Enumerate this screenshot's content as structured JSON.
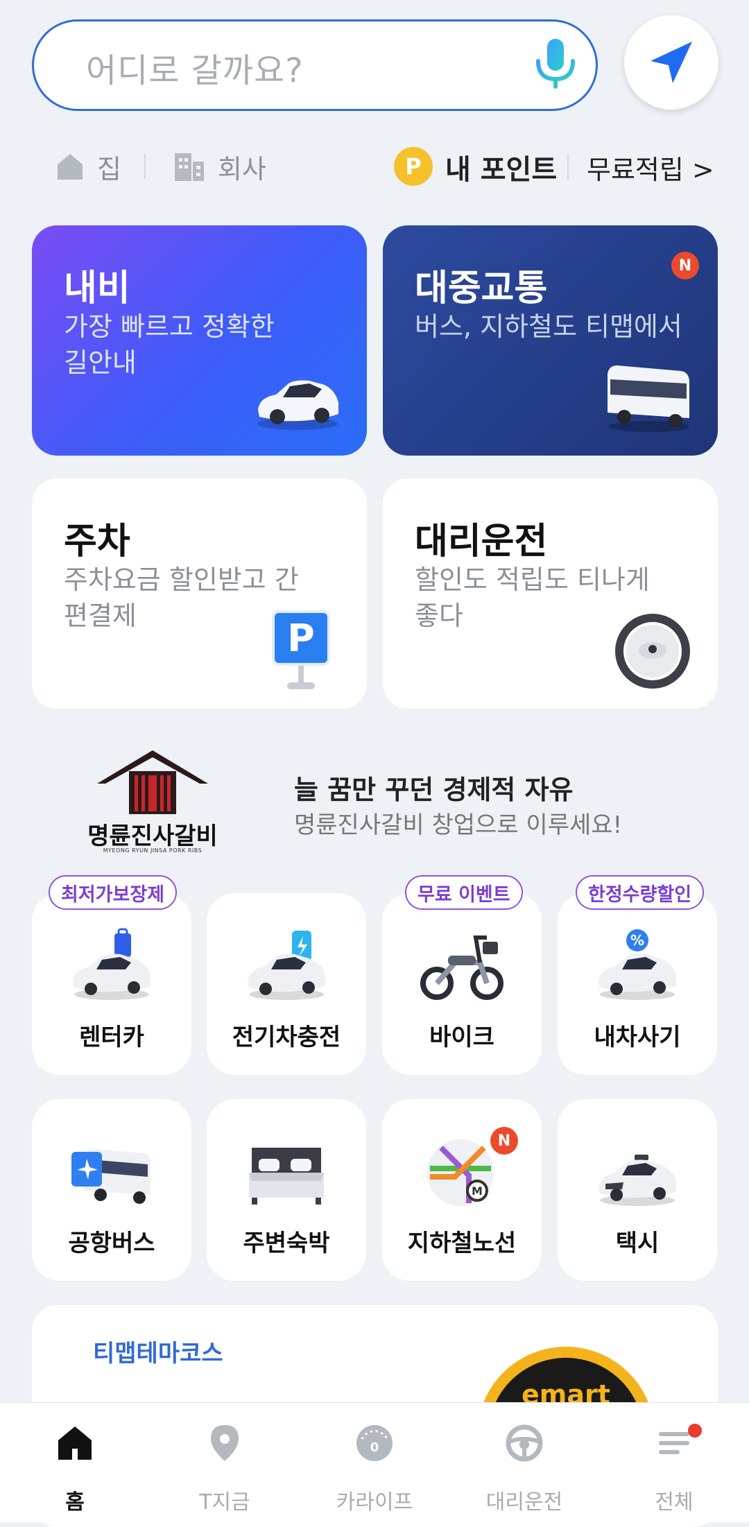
{
  "search": {
    "placeholder": "어디로 갈까요?"
  },
  "shortcuts": {
    "home": "집",
    "work": "회사",
    "point_coin": "P",
    "my_points": "내 포인트",
    "free_earn": "무료적립 >"
  },
  "cards": {
    "navi": {
      "title": "내비",
      "subtitle": "가장 빠르고 정확한 길안내"
    },
    "transit": {
      "title": "대중교통",
      "subtitle": "버스, 지하철도 티맵에서",
      "badge": "N"
    },
    "parking": {
      "title": "주차",
      "subtitle": "주차요금 할인받고 간편결제",
      "icon_text": "P"
    },
    "driver": {
      "title": "대리운전",
      "subtitle": "할인도 적립도 티나게 좋다"
    }
  },
  "ad": {
    "brand": "명륜진사갈비",
    "brand_en": "MYEONG RYUN JINSA PORK RIBS",
    "title": "늘 꿈만 꾸던 경제적 자유",
    "subtitle": "명륜진사갈비 창업으로 이루세요!"
  },
  "services": [
    {
      "label": "렌터카",
      "tag": "최저가보장제"
    },
    {
      "label": "전기차충전"
    },
    {
      "label": "바이크",
      "tag": "무료 이벤트"
    },
    {
      "label": "내차사기",
      "tag": "한정수량할인"
    },
    {
      "label": "공항버스"
    },
    {
      "label": "주변숙박"
    },
    {
      "label": "지하철노선",
      "badge": "N"
    },
    {
      "label": "택시"
    }
  ],
  "promo": {
    "title": "티맵테마코스",
    "brand_logo": "emart"
  },
  "bottom_nav": [
    {
      "label": "홈",
      "icon": "home-icon",
      "active": true
    },
    {
      "label": "T지금",
      "icon": "location-pin-icon"
    },
    {
      "label": "카라이프",
      "icon": "gauge-icon",
      "gauge_value": "0"
    },
    {
      "label": "대리운전",
      "icon": "steering-wheel-icon"
    },
    {
      "label": "전체",
      "icon": "menu-icon",
      "notification_dot": true
    }
  ],
  "colors": {
    "accent_blue": "#2d6fd6",
    "navi_gradient_start": "#7b4cf5",
    "transit_bg": "#1f3577",
    "tag_purple": "#7a3fd0",
    "badge_red": "#ec4a2c",
    "page_bg": "#eef1f6"
  }
}
